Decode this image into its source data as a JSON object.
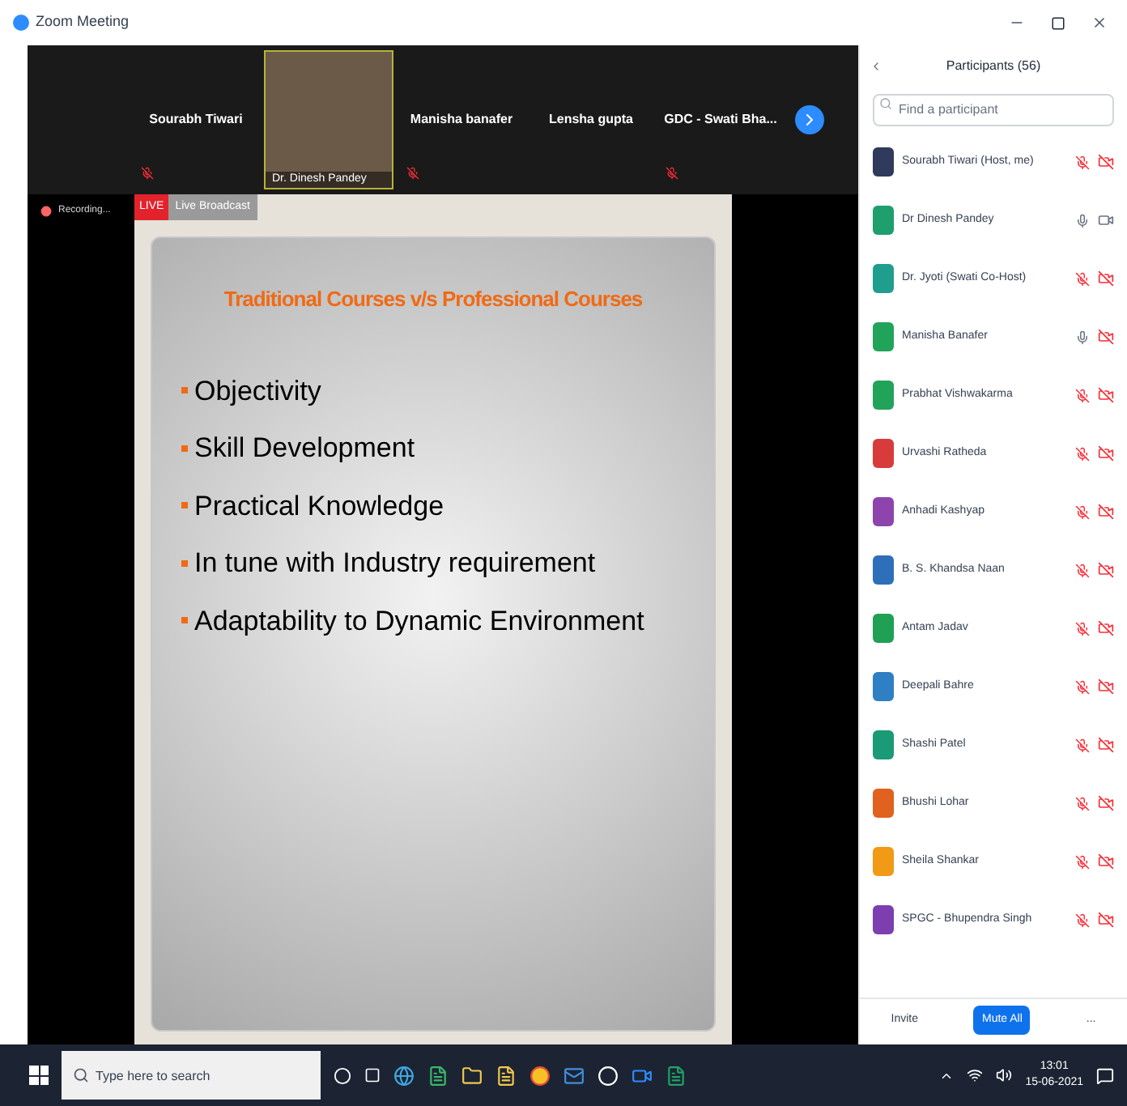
{
  "window": {
    "title": "Zoom Meeting"
  },
  "gallery": [
    {
      "name": "Sourabh Tiwari",
      "kind": "name",
      "mic_muted": true
    },
    {
      "name": "Dr. Dinesh Pandey",
      "kind": "video",
      "mic_muted": false
    },
    {
      "name": "Manisha banafer",
      "kind": "name",
      "mic_muted": true
    },
    {
      "name": "Lensha gupta",
      "kind": "name",
      "mic_muted": false
    },
    {
      "name": "GDC - Swati Bha...",
      "kind": "name",
      "mic_muted": true
    }
  ],
  "recording": "Recording...",
  "share_bar": {
    "live": "LIVE",
    "label": "Live Broadcast"
  },
  "slide": {
    "title": "Traditional Courses v/s Professional Courses",
    "bullets": [
      "Objectivity",
      "Skill Development",
      "Practical Knowledge",
      "In tune with Industry requirement",
      "Adaptability to Dynamic Environment"
    ]
  },
  "participants": {
    "title": "Participants (56)",
    "search_placeholder": "Find a participant",
    "items": [
      {
        "name": "Sourabh Tiwari (Host, me)",
        "color": "#2f3a5c",
        "mic_muted": true,
        "video_off": true
      },
      {
        "name": "Dr Dinesh Pandey",
        "color": "#1f9e6e",
        "mic_muted": false,
        "video_off": false
      },
      {
        "name": "Dr. Jyoti (Swati Co-Host)",
        "color": "#1f9e8e",
        "mic_muted": true,
        "video_off": true
      },
      {
        "name": "Manisha Banafer",
        "color": "#22a35a",
        "mic_muted": false,
        "video_off": true
      },
      {
        "name": "Prabhat Vishwakarma",
        "color": "#22a35a",
        "mic_muted": true,
        "video_off": true
      },
      {
        "name": "Urvashi Ratheda",
        "color": "#d83b3b",
        "mic_muted": true,
        "video_off": true
      },
      {
        "name": "Anhadi Kashyap",
        "color": "#8e44ad",
        "mic_muted": true,
        "video_off": true
      },
      {
        "name": "B. S. Khandsa Naan",
        "color": "#2e6fba",
        "mic_muted": true,
        "video_off": true
      },
      {
        "name": "Antam Jadav",
        "color": "#1fa055",
        "mic_muted": true,
        "video_off": true
      },
      {
        "name": "Deepali Bahre",
        "color": "#2e7fc4",
        "mic_muted": true,
        "video_off": true
      },
      {
        "name": "Shashi Patel",
        "color": "#1a9a76",
        "mic_muted": true,
        "video_off": true
      },
      {
        "name": "Bhushi Lohar",
        "color": "#e0621e",
        "mic_muted": true,
        "video_off": true
      },
      {
        "name": "Sheila Shankar",
        "color": "#f09a16",
        "mic_muted": true,
        "video_off": true
      },
      {
        "name": "SPGC - Bhupendra Singh",
        "color": "#7d3fb0",
        "mic_muted": true,
        "video_off": true
      }
    ],
    "buttons": [
      "Invite",
      "Mute All",
      "..."
    ]
  },
  "taskbar": {
    "search_placeholder": "Type here to search",
    "time": "13:01",
    "date": "15-06-2021"
  }
}
